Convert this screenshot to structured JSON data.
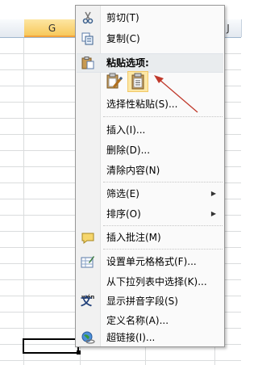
{
  "sheet": {
    "columns": [
      "G",
      "",
      "",
      "J"
    ],
    "active_column": "G"
  },
  "menu": {
    "cut": "剪切(T)",
    "copy": "复制(C)",
    "paste_options_title": "粘贴选项:",
    "paste_special": "选择性粘贴(S)...",
    "insert": "插入(I)...",
    "delete": "删除(D)...",
    "clear_contents": "清除内容(N)",
    "filter": "筛选(E)",
    "sort": "排序(O)",
    "insert_comment": "插入批注(M)",
    "format_cells": "设置单元格格式(F)...",
    "pick_from_list": "从下拉列表中选择(K)...",
    "show_phonetic": "显示拼音字段(S)",
    "define_name": "定义名称(A)...",
    "hyperlink": "超链接(I)...",
    "submenu_arrow": "▶",
    "phonetic_icon_text": "wén",
    "phonetic_icon_char": "文"
  },
  "colors": {
    "annotation_arrow": "#c0392b",
    "highlight": "#fce7a5",
    "header_selected": "#f7c95c"
  }
}
